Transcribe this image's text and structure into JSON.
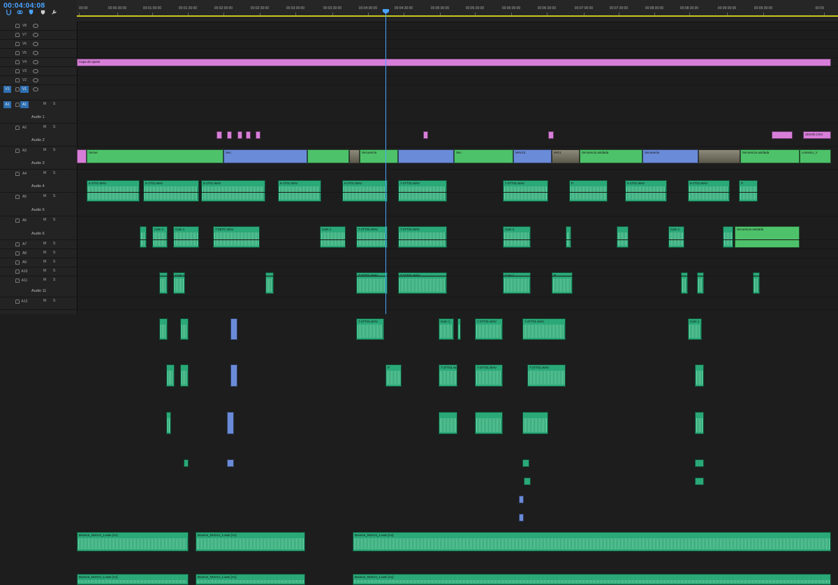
{
  "timecode": "00:04:04:08",
  "colors": {
    "accent": "#4aa3ff",
    "audio_clip": "#2aa878",
    "video_clip": "#6a8bd8",
    "title_clip": "#d77ed8",
    "green_clip": "#4ec26a",
    "work_area": "#c8c820"
  },
  "tools": [
    "snap-icon",
    "linked-selection-icon",
    "add-marker-icon",
    "settings-wrench-icon"
  ],
  "ruler": {
    "labels": [
      "00:00",
      "00:00:30:00",
      "00:01:00:00",
      "00:01:30:00",
      "00:02:00:00",
      "00:02:30:00",
      "00:03:00:00",
      "00:03:30:00",
      "00:04:00:00",
      "00:04:30:00",
      "00:05:00:00",
      "00:05:30:00",
      "00:06:00:00",
      "00:06:30:00",
      "00:07:00:00",
      "00:07:30:00",
      "00:08:00:00",
      "00:08:30:00",
      "00:09:00:00",
      "00:09:30:00",
      "00:09"
    ]
  },
  "tracks": [
    {
      "id": "V8",
      "name": "",
      "type": "video",
      "source": ""
    },
    {
      "id": "V7",
      "name": "",
      "type": "video",
      "source": ""
    },
    {
      "id": "V6",
      "name": "",
      "type": "video",
      "source": ""
    },
    {
      "id": "V5",
      "name": "",
      "type": "video",
      "source": ""
    },
    {
      "id": "V4",
      "name": "",
      "type": "video",
      "source": ""
    },
    {
      "id": "V3",
      "name": "",
      "type": "video",
      "source": ""
    },
    {
      "id": "V2",
      "name": "",
      "type": "video",
      "source": ""
    },
    {
      "id": "V1",
      "name": "",
      "type": "video",
      "source": "V1"
    },
    {
      "id": "A1",
      "name": "Audio 1",
      "type": "audio",
      "source": "A1"
    },
    {
      "id": "A2",
      "name": "Audio 2",
      "type": "audio",
      "source": ""
    },
    {
      "id": "A3",
      "name": "Audio 3",
      "type": "audio",
      "source": ""
    },
    {
      "id": "A4",
      "name": "Audio 4",
      "type": "audio",
      "source": ""
    },
    {
      "id": "A5",
      "name": "Audio 5",
      "type": "audio",
      "source": ""
    },
    {
      "id": "A6",
      "name": "Audio 6",
      "type": "audio",
      "source": ""
    },
    {
      "id": "A7",
      "name": "",
      "type": "audio",
      "source": ""
    },
    {
      "id": "A8",
      "name": "",
      "type": "audio",
      "source": ""
    },
    {
      "id": "A9",
      "name": "",
      "type": "audio",
      "source": ""
    },
    {
      "id": "A10",
      "name": "",
      "type": "audio",
      "source": ""
    },
    {
      "id": "A11",
      "name": "Audio 11",
      "type": "audio",
      "source": ""
    },
    {
      "id": "A12",
      "name": "",
      "type": "audio",
      "source": ""
    }
  ],
  "track_buttons": {
    "mute": "M",
    "solo": "S"
  },
  "clip_labels": {
    "title": "Capa de ajuste",
    "sequence": "Secuencia anidada",
    "sequence_short": "Secuencia",
    "bounce": "Bounce_NUGAI_1.wav [A1]",
    "audio_a": "6-1T01.WAV",
    "audio_b": "7-2TT01.WAV",
    "audio_c": "7-2ETC.WAV",
    "cam": "Cam 1",
    "cam2": "Cam 2",
    "short": "P.",
    "v1_a": "Secue",
    "v1_b": "Sec.",
    "v1_c": "MAV13",
    "v1_d": "IMG1",
    "v1_end": "contexto_V",
    "v2_end": "cEsHO.CXU"
  }
}
